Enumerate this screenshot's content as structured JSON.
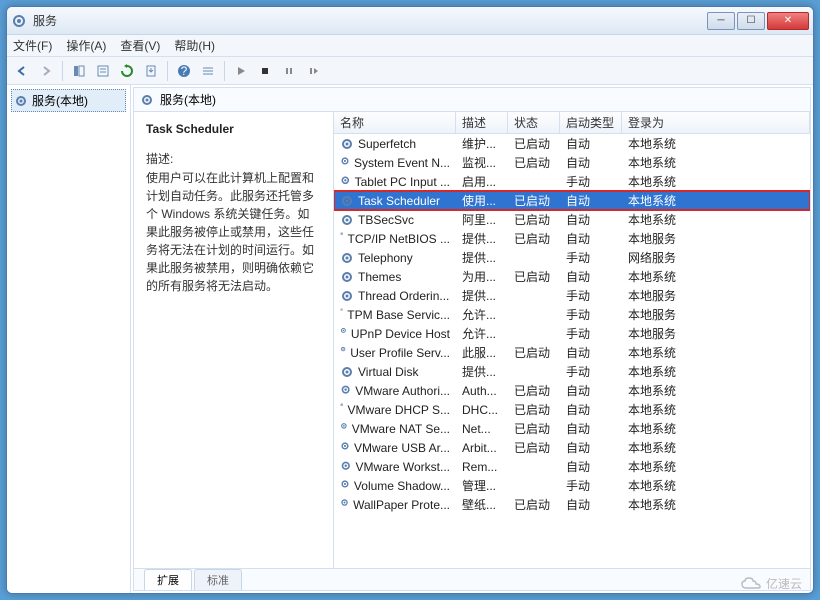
{
  "window": {
    "title": "服务"
  },
  "menubar": [
    "文件(F)",
    "操作(A)",
    "查看(V)",
    "帮助(H)"
  ],
  "nav": {
    "root": "服务(本地)"
  },
  "mainhdr": "服务(本地)",
  "detail": {
    "title": "Task Scheduler",
    "desc_label": "描述:",
    "desc": "使用户可以在此计算机上配置和计划自动任务。此服务还托管多个 Windows 系统关键任务。如果此服务被停止或禁用，这些任务将无法在计划的时间运行。如果此服务被禁用，则明确依赖它的所有服务将无法启动。"
  },
  "columns": [
    "名称",
    "描述",
    "状态",
    "启动类型",
    "登录为"
  ],
  "services": [
    {
      "name": "Superfetch",
      "desc": "维护...",
      "status": "已启动",
      "start": "自动",
      "logon": "本地系统"
    },
    {
      "name": "System Event N...",
      "desc": "监视...",
      "status": "已启动",
      "start": "自动",
      "logon": "本地系统"
    },
    {
      "name": "Tablet PC Input ...",
      "desc": "启用...",
      "status": "",
      "start": "手动",
      "logon": "本地系统"
    },
    {
      "name": "Task Scheduler",
      "desc": "使用...",
      "status": "已启动",
      "start": "自动",
      "logon": "本地系统",
      "selected": true,
      "boxed": true
    },
    {
      "name": "TBSecSvc",
      "desc": "阿里...",
      "status": "已启动",
      "start": "自动",
      "logon": "本地系统"
    },
    {
      "name": "TCP/IP NetBIOS ...",
      "desc": "提供...",
      "status": "已启动",
      "start": "自动",
      "logon": "本地服务"
    },
    {
      "name": "Telephony",
      "desc": "提供...",
      "status": "",
      "start": "手动",
      "logon": "网络服务"
    },
    {
      "name": "Themes",
      "desc": "为用...",
      "status": "已启动",
      "start": "自动",
      "logon": "本地系统"
    },
    {
      "name": "Thread Orderin...",
      "desc": "提供...",
      "status": "",
      "start": "手动",
      "logon": "本地服务"
    },
    {
      "name": "TPM Base Servic...",
      "desc": "允许...",
      "status": "",
      "start": "手动",
      "logon": "本地服务"
    },
    {
      "name": "UPnP Device Host",
      "desc": "允许...",
      "status": "",
      "start": "手动",
      "logon": "本地服务"
    },
    {
      "name": "User Profile Serv...",
      "desc": "此服...",
      "status": "已启动",
      "start": "自动",
      "logon": "本地系统"
    },
    {
      "name": "Virtual Disk",
      "desc": "提供...",
      "status": "",
      "start": "手动",
      "logon": "本地系统"
    },
    {
      "name": "VMware Authori...",
      "desc": "Auth...",
      "status": "已启动",
      "start": "自动",
      "logon": "本地系统"
    },
    {
      "name": "VMware DHCP S...",
      "desc": "DHC...",
      "status": "已启动",
      "start": "自动",
      "logon": "本地系统"
    },
    {
      "name": "VMware NAT Se...",
      "desc": "Net...",
      "status": "已启动",
      "start": "自动",
      "logon": "本地系统"
    },
    {
      "name": "VMware USB Ar...",
      "desc": "Arbit...",
      "status": "已启动",
      "start": "自动",
      "logon": "本地系统"
    },
    {
      "name": "VMware Workst...",
      "desc": "Rem...",
      "status": "",
      "start": "自动",
      "logon": "本地系统"
    },
    {
      "name": "Volume Shadow...",
      "desc": "管理...",
      "status": "",
      "start": "手动",
      "logon": "本地系统"
    },
    {
      "name": "WallPaper Prote...",
      "desc": "壁纸...",
      "status": "已启动",
      "start": "自动",
      "logon": "本地系统"
    }
  ],
  "tabs": [
    "扩展",
    "标准"
  ],
  "watermark": "亿速云"
}
